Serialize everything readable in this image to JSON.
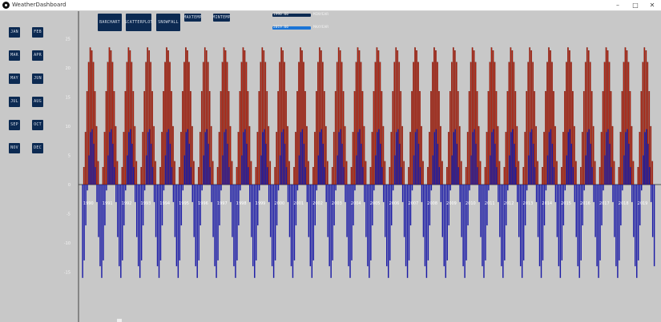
{
  "window": {
    "title": "WeatherDashboard",
    "minimize": "–",
    "maximize": "□",
    "close": "✕"
  },
  "months": [
    "JAN",
    "FEB",
    "MAR",
    "APR",
    "MAY",
    "JUN",
    "JUL",
    "AUG",
    "SEP",
    "OCT",
    "NOV",
    "DEC"
  ],
  "toolbar": {
    "barchart": "BARCHART",
    "scatterplot": "SCATTERPLOT",
    "snowfall": "SNOWFALL",
    "maxtemp": "MAXTEMP",
    "mintemp": "MINTEMP"
  },
  "sliders": {
    "start": {
      "value": "1990.00",
      "label": "MINYEAR",
      "fill": 1.0
    },
    "end": {
      "value": "2019.00",
      "label": "MAXYEAR",
      "fill": 1.0
    }
  },
  "colors": {
    "background": "#c8c8c8",
    "button": "#0c2a52",
    "max_series": "#b3200c",
    "min_series": "#1a1aa6",
    "slider_start": "#0c2a52",
    "slider_end": "#1a74d6"
  },
  "chart_data": {
    "type": "bar",
    "title": "",
    "xlabel": "",
    "ylabel": "",
    "ylim": [
      -16,
      28
    ],
    "yticks": [
      25,
      20,
      15,
      10,
      5,
      0,
      -5,
      -10,
      -15
    ],
    "years": [
      "1990",
      "1991",
      "1992",
      "1993",
      "1994",
      "1995",
      "1996",
      "1997",
      "1998",
      "1999",
      "2000",
      "2001",
      "2002",
      "2003",
      "2004",
      "2005",
      "2006",
      "2007",
      "2008",
      "2009",
      "2010",
      "2011",
      "2012",
      "2013",
      "2014",
      "2015",
      "2016",
      "2017",
      "2018",
      "2019"
    ],
    "months_per_year": 12,
    "series": [
      {
        "values_by_month": [
          0,
          3,
          9,
          16,
          21,
          23.5,
          23,
          21,
          16,
          10,
          4,
          0
        ]
      },
      {
        "values_by_month": [
          -16,
          -13,
          -7,
          -1,
          5,
          9,
          9.5,
          7,
          3,
          -3,
          -9,
          -14
        ]
      }
    ]
  }
}
